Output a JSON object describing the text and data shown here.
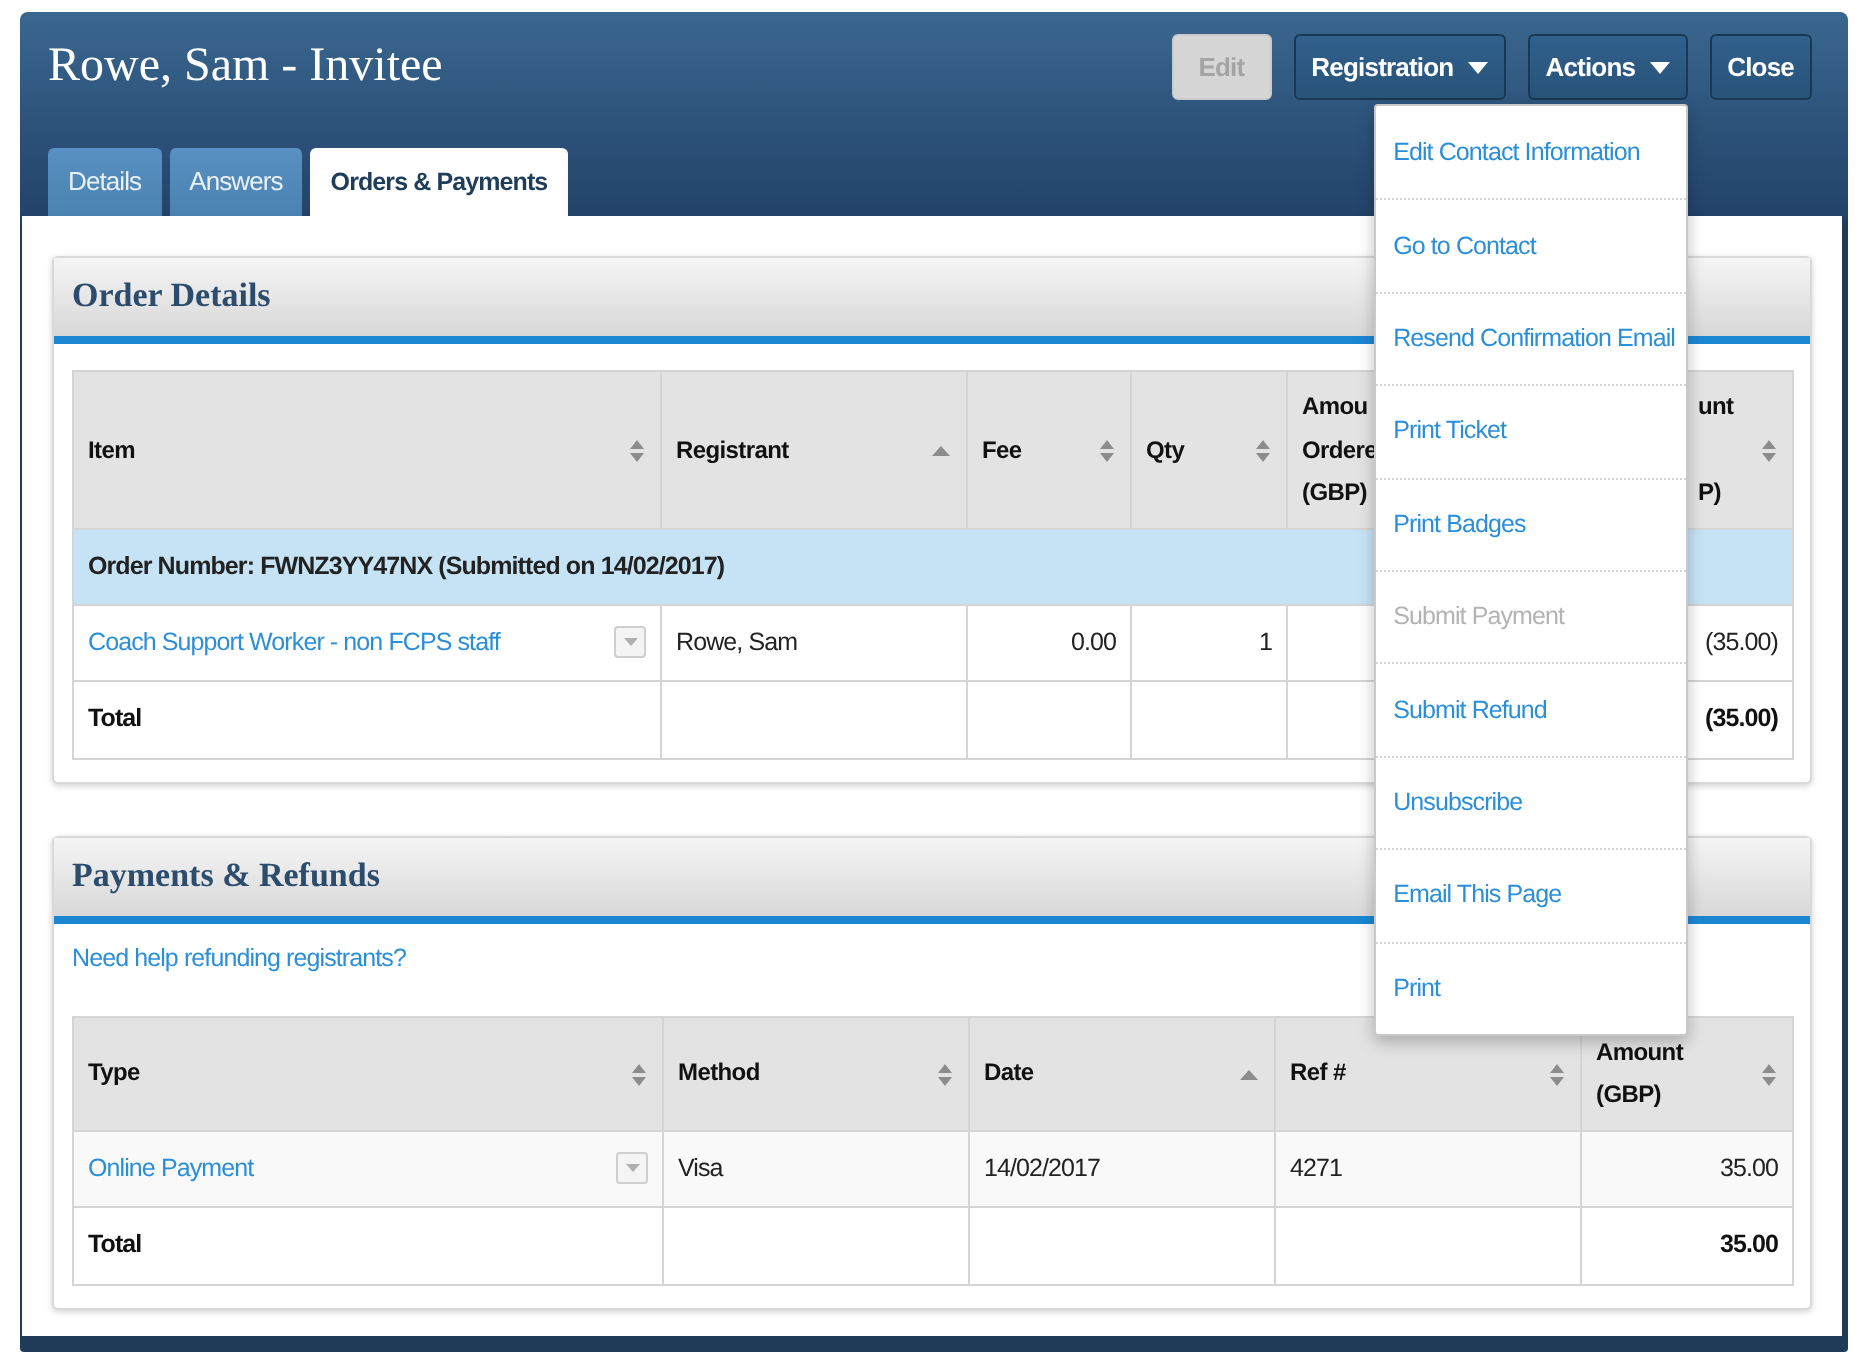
{
  "window": {
    "title": "Rowe, Sam - Invitee"
  },
  "header_buttons": [
    {
      "label": "Edit",
      "kind": "plain",
      "disabled": true
    },
    {
      "label": "Registration",
      "kind": "dropdown",
      "disabled": false
    },
    {
      "label": "Actions",
      "kind": "dropdown",
      "disabled": false,
      "menu": [
        {
          "label": "Edit Contact Information",
          "disabled": false
        },
        {
          "label": "Go to Contact",
          "disabled": false
        },
        {
          "label": "Resend Confirmation Email",
          "disabled": false
        },
        {
          "label": "Print Ticket",
          "disabled": false
        },
        {
          "label": "Print Badges",
          "disabled": false
        },
        {
          "label": "Submit Payment",
          "disabled": true
        },
        {
          "label": "Submit Refund",
          "disabled": false
        },
        {
          "label": "Unsubscribe",
          "disabled": false
        },
        {
          "label": "Email This Page",
          "disabled": false
        },
        {
          "label": "Print",
          "disabled": false
        }
      ]
    },
    {
      "label": "Close",
      "kind": "plain",
      "disabled": false
    }
  ],
  "tabs": [
    {
      "label": "Details",
      "selected": false
    },
    {
      "label": "Answers",
      "selected": false
    },
    {
      "label": "Orders & Payments",
      "selected": true
    }
  ],
  "order_details": {
    "title": "Order Details",
    "table": {
      "columns": [
        {
          "label": "Item",
          "kind": "text",
          "sorted": false
        },
        {
          "label": "Registrant",
          "kind": "text",
          "sorted": true
        },
        {
          "label": "Fee",
          "kind": "number",
          "sorted": false
        },
        {
          "label": "Qty",
          "kind": "number",
          "sorted": false
        },
        {
          "label": "Amou\nOrdere\n(GBP)",
          "kind": "number"
        },
        {
          "label": "unt\n\nP)",
          "kind": "number",
          "sorted": false
        }
      ],
      "group_row": "Order Number: FWNZ3YY47NX (Submitted on 14/02/2017)",
      "rows": [
        {
          "kind": "entry",
          "cells": [
            "Coach Support Worker - non FCPS staff",
            "Rowe, Sam",
            "0.00",
            "1",
            null,
            "(35.00)"
          ]
        },
        {
          "kind": "total",
          "cells": [
            "Total",
            null,
            null,
            null,
            null,
            "(35.00)"
          ]
        }
      ]
    }
  },
  "payments_refunds": {
    "title": "Payments & Refunds",
    "help_link": "Need help refunding registrants?",
    "table": {
      "columns": [
        {
          "label": "Type",
          "kind": "text",
          "sorted": false
        },
        {
          "label": "Method",
          "kind": "text",
          "sorted": false
        },
        {
          "label": "Date",
          "kind": "text",
          "sorted": true
        },
        {
          "label": "Ref #",
          "kind": "text",
          "sorted": false
        },
        {
          "label": "Amount\n(GBP)",
          "kind": "number",
          "sorted": false
        }
      ],
      "rows": [
        {
          "kind": "entry",
          "cells": [
            "Online Payment",
            "Visa",
            "14/02/2017",
            "4271",
            "35.00"
          ]
        },
        {
          "kind": "total",
          "cells": [
            "Total",
            null,
            null,
            null,
            "35.00"
          ]
        }
      ]
    }
  }
}
